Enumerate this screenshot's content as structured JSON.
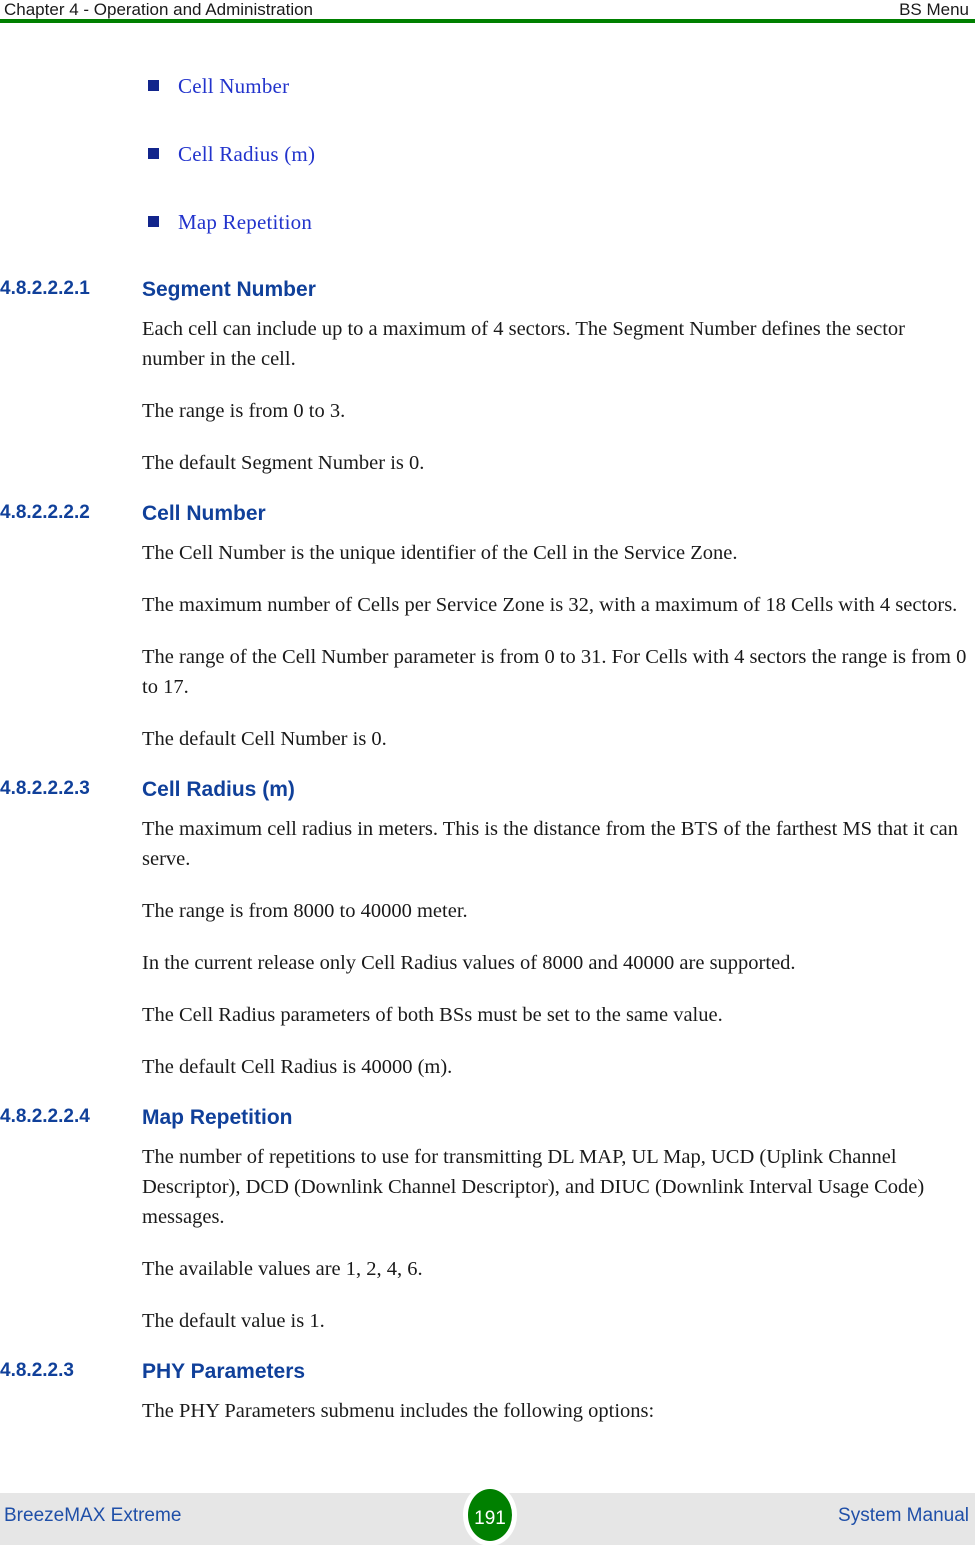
{
  "header": {
    "left": "Chapter 4 - Operation and Administration",
    "right": "BS Menu",
    "rule_color": "#008000"
  },
  "bullets": [
    {
      "label": "Cell Number"
    },
    {
      "label": "Cell Radius (m)"
    },
    {
      "label": "Map Repetition"
    }
  ],
  "sections": [
    {
      "number": "4.8.2.2.2.1",
      "title": "Segment Number",
      "paragraphs": [
        "Each cell can include up to a maximum of 4 sectors. The Segment Number defines the sector number in the cell.",
        "The range is from 0 to 3.",
        "The default Segment Number is 0."
      ]
    },
    {
      "number": "4.8.2.2.2.2",
      "title": "Cell Number",
      "paragraphs": [
        "The Cell Number is the unique identifier of the Cell in the Service Zone.",
        "The maximum number of Cells per Service Zone is 32, with a maximum of 18 Cells with 4 sectors.",
        "The range of the Cell Number parameter is from 0 to 31. For Cells with 4 sectors the range is from 0 to 17.",
        "The default Cell Number is 0."
      ]
    },
    {
      "number": "4.8.2.2.2.3",
      "title": "Cell Radius (m)",
      "paragraphs": [
        "The maximum cell radius in meters. This is the distance from the BTS of the farthest MS that it can serve.",
        "The range is from 8000 to 40000 meter.",
        "In the current release only Cell Radius values of 8000 and 40000 are supported.",
        "The Cell Radius parameters of both BSs must be set to the same value.",
        "The default Cell Radius is 40000 (m)."
      ]
    },
    {
      "number": "4.8.2.2.2.4",
      "title": "Map Repetition",
      "paragraphs": [
        "The number of repetitions to use for transmitting DL MAP, UL Map, UCD (Uplink Channel Descriptor), DCD (Downlink Channel Descriptor), and DIUC (Downlink Interval Usage Code) messages.",
        "The available values are 1, 2, 4, 6.",
        "The default value is 1."
      ]
    },
    {
      "number": "4.8.2.2.3",
      "title": "PHY Parameters",
      "paragraphs": [
        "The PHY Parameters submenu includes the following options:"
      ]
    }
  ],
  "footer": {
    "left": "BreezeMAX Extreme",
    "right": "System Manual",
    "page_number": "191",
    "badge_color": "#008000",
    "band_color": "#e6e6e6",
    "text_color": "#1f4fa8"
  }
}
